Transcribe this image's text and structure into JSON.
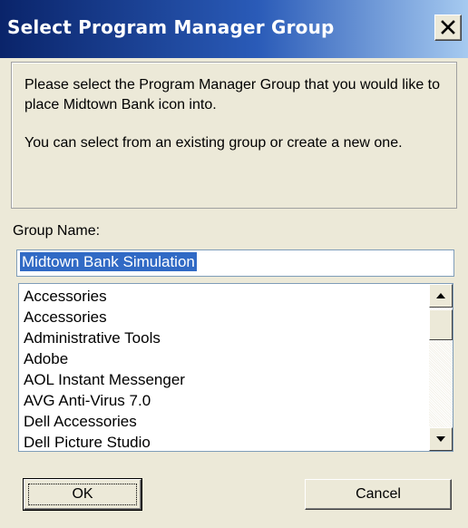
{
  "window": {
    "title": "Select Program Manager Group"
  },
  "message": {
    "line1": "Please select the Program Manager Group that you would like to place Midtown Bank icon into.",
    "line2": "You can select from an existing group or create a new one."
  },
  "group": {
    "label": "Group Name:",
    "value": "Midtown Bank Simulation"
  },
  "groups_list": {
    "items": [
      "Accessories",
      "Accessories",
      "Administrative Tools",
      "Adobe",
      "AOL Instant Messenger",
      "AVG Anti-Virus 7.0",
      "Dell Accessories",
      "Dell Picture Studio"
    ]
  },
  "buttons": {
    "ok_label": "OK",
    "cancel_label": "Cancel"
  },
  "colors": {
    "titlebar_start": "#0a246a",
    "titlebar_end": "#a6caf0",
    "dialog_bg": "#ece9d8",
    "selection": "#316ac5"
  },
  "icons": {
    "close": "close-icon",
    "scroll_up": "arrow-up-icon",
    "scroll_down": "arrow-down-icon"
  }
}
